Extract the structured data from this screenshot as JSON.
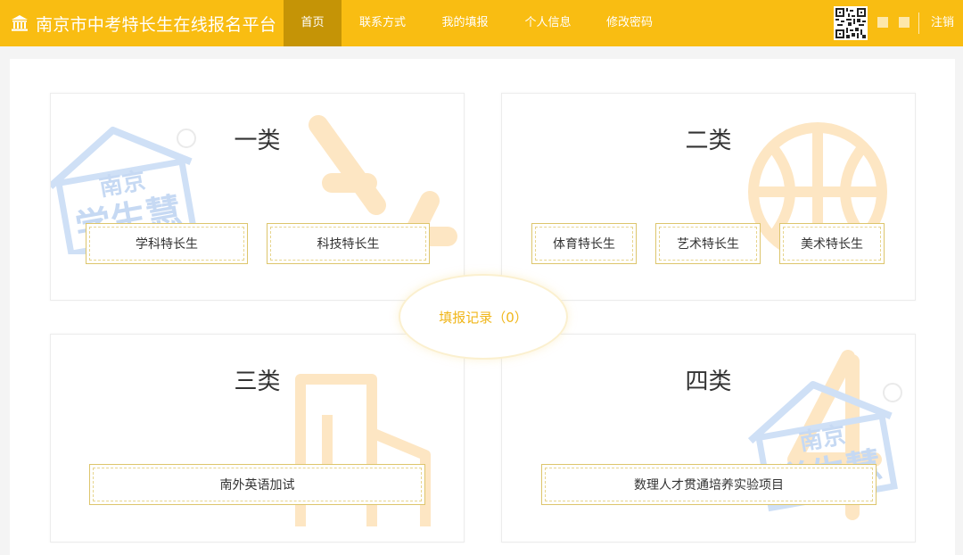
{
  "header": {
    "brand": "南京市中考特长生在线报名平台",
    "nav": [
      {
        "label": "首页",
        "active": true
      },
      {
        "label": "联系方式",
        "active": false
      },
      {
        "label": "我的填报",
        "active": false
      },
      {
        "label": "个人信息",
        "active": false
      },
      {
        "label": "修改密码",
        "active": false
      }
    ],
    "logout": "注销"
  },
  "cards": {
    "c1": {
      "title": "一类",
      "options": [
        "学科特长生",
        "科技特长生"
      ]
    },
    "c2": {
      "title": "二类",
      "options": [
        "体育特长生",
        "艺术特长生",
        "美术特长生"
      ]
    },
    "c3": {
      "title": "三类",
      "options": [
        "南外英语加试"
      ]
    },
    "c4": {
      "title": "四类",
      "options": [
        "数理人才贯通培养实验项目"
      ]
    }
  },
  "records": {
    "label": "填报记录（0）"
  },
  "watermark": {
    "line1": "南京",
    "line2": "学生慧"
  },
  "colors": {
    "header": "#f9bd12",
    "nav_active": "#c59406",
    "accent": "#f0b61a",
    "option_border": "#ddc56c"
  }
}
